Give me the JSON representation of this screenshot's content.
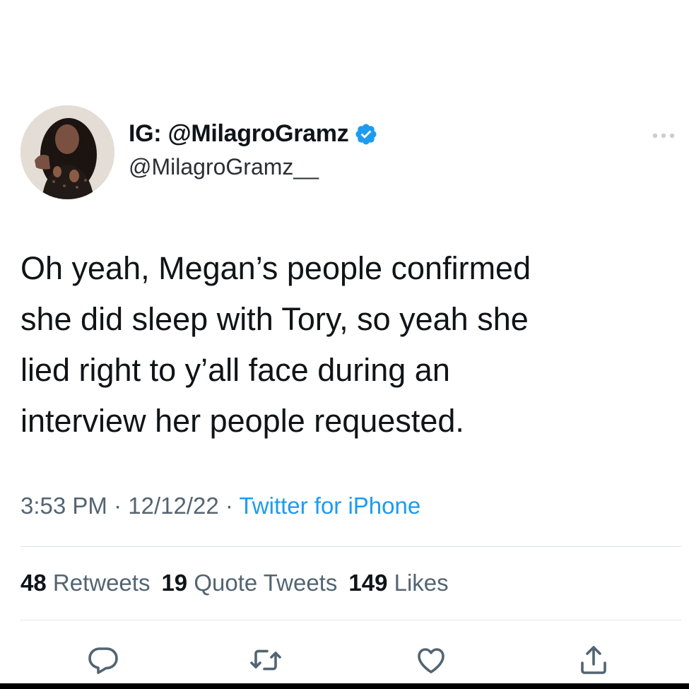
{
  "author": {
    "display_name": "IG: @MilagroGramz",
    "handle": "@MilagroGramz__",
    "avatar_icon": "profile-photo",
    "verified": true,
    "verified_color": "#1d9bf0"
  },
  "tweet": {
    "lines": [
      "Oh yeah, Megan’s people confirmed",
      "she did sleep with Tory, so yeah she",
      "lied right to y’all face during an",
      "interview her people requested."
    ]
  },
  "meta": {
    "time": "3:53 PM",
    "separator": " · ",
    "date": "12/12/22",
    "source": "Twitter for iPhone",
    "source_color": "#1d9bf0"
  },
  "stats": {
    "retweets_count": "48",
    "retweets_label": " Retweets",
    "quotes_count": "19",
    "quotes_label": " Quote Tweets",
    "likes_count": "149",
    "likes_label": " Likes"
  },
  "actions": [
    {
      "icon": "reply-icon"
    },
    {
      "icon": "retweet-icon"
    },
    {
      "icon": "like-icon"
    },
    {
      "icon": "share-icon"
    }
  ],
  "more_icon": "more-options-icon"
}
